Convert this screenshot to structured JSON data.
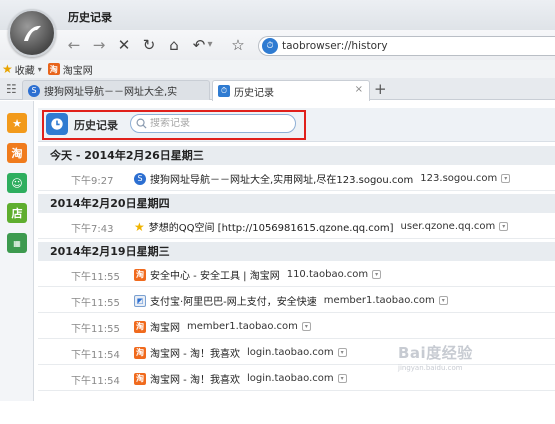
{
  "window": {
    "title": "历史记录"
  },
  "nav": {
    "back_glyph": "←",
    "forward_glyph": "→",
    "stop_glyph": "✕",
    "refresh_glyph": "↻",
    "home_glyph": "⌂",
    "undo_glyph": "↶",
    "menu_glyph": "▾",
    "star_glyph": "☆",
    "address": "taobrowser://history"
  },
  "favbar": {
    "favorites_label": "收藏",
    "taobao_label": "淘宝网"
  },
  "tabs": [
    {
      "label": "搜狗网址导航－－网址大全,实",
      "active": false
    },
    {
      "label": "历史记录",
      "active": true
    }
  ],
  "tab_close": "×",
  "tab_add": "+",
  "history": {
    "title": "历史记录",
    "search_placeholder": "搜索记录",
    "groups": [
      {
        "day": "今天 - 2014年2月26日星期三",
        "entries": [
          {
            "time": "下午9:27",
            "icon": "sogou-icon",
            "title": "搜狗网址导航－－网址大全,实用网址,尽在123.sogou.com",
            "url": "123.sogou.com"
          }
        ]
      },
      {
        "day": "2014年2月20日星期四",
        "entries": [
          {
            "time": "下午7:43",
            "icon": "qzone-star-icon",
            "title": "梦想的QQ空间 [http://1056981615.qzone.qq.com]",
            "url": "user.qzone.qq.com"
          }
        ]
      },
      {
        "day": "2014年2月19日星期三",
        "entries": [
          {
            "time": "下午11:55",
            "icon": "taobao-icon",
            "title": "安全中心 - 安全工具 | 淘宝网",
            "url": "110.taobao.com"
          },
          {
            "time": "下午11:55",
            "icon": "alipay-icon",
            "title": "支付宝·阿里巴巴-网上支付，安全快速",
            "url": "member1.taobao.com"
          },
          {
            "time": "下午11:55",
            "icon": "taobao-icon",
            "title": "淘宝网",
            "url": "member1.taobao.com"
          },
          {
            "time": "下午11:54",
            "icon": "taobao-icon",
            "title": "淘宝网 - 淘！我喜欢",
            "url": "login.taobao.com"
          },
          {
            "time": "下午11:54",
            "icon": "taobao-icon",
            "title": "淘宝网 - 淘！我喜欢",
            "url": "login.taobao.com"
          }
        ]
      }
    ]
  },
  "watermark": {
    "text": "Bai度经验",
    "sub": "jingyan.baidu.com"
  },
  "colors": {
    "accent": "#2f7bd1",
    "highlight": "#e0201b",
    "taobao": "#f06a1d"
  }
}
